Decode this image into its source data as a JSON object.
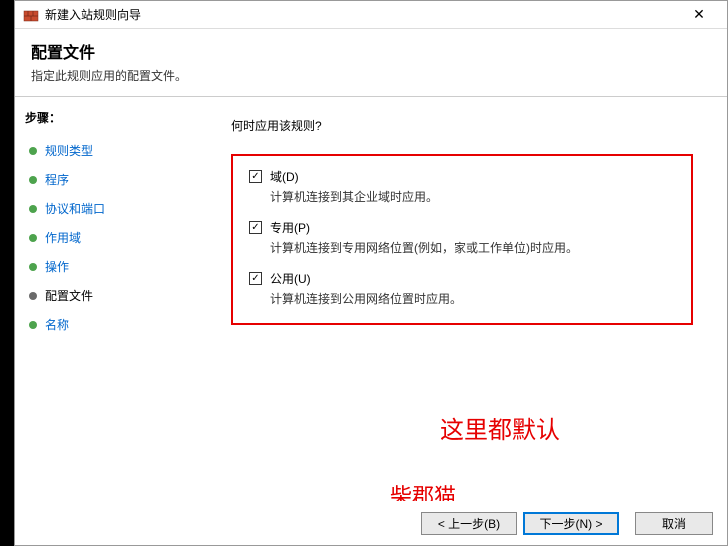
{
  "titlebar": {
    "title": "新建入站规则向导"
  },
  "header": {
    "title": "配置文件",
    "desc": "指定此规则应用的配置文件。"
  },
  "sidebar": {
    "steps_label": "步骤：",
    "items": [
      {
        "label": "规则类型",
        "current": false
      },
      {
        "label": "程序",
        "current": false
      },
      {
        "label": "协议和端口",
        "current": false
      },
      {
        "label": "作用域",
        "current": false
      },
      {
        "label": "操作",
        "current": false
      },
      {
        "label": "配置文件",
        "current": true
      },
      {
        "label": "名称",
        "current": false
      }
    ]
  },
  "content": {
    "prompt": "何时应用该规则?",
    "checkboxes": [
      {
        "label": "域(D)",
        "desc": "计算机连接到其企业域时应用。",
        "checked": true
      },
      {
        "label": "专用(P)",
        "desc": "计算机连接到专用网络位置(例如，家或工作单位)时应用。",
        "checked": true
      },
      {
        "label": "公用(U)",
        "desc": "计算机连接到公用网络位置时应用。",
        "checked": true
      }
    ]
  },
  "annotations": {
    "note1": "这里都默认",
    "watermark": "柴郡猫\nwww.cheshirex.com"
  },
  "footer": {
    "back": "< 上一步(B)",
    "next": "下一步(N) >",
    "cancel": "取消"
  }
}
